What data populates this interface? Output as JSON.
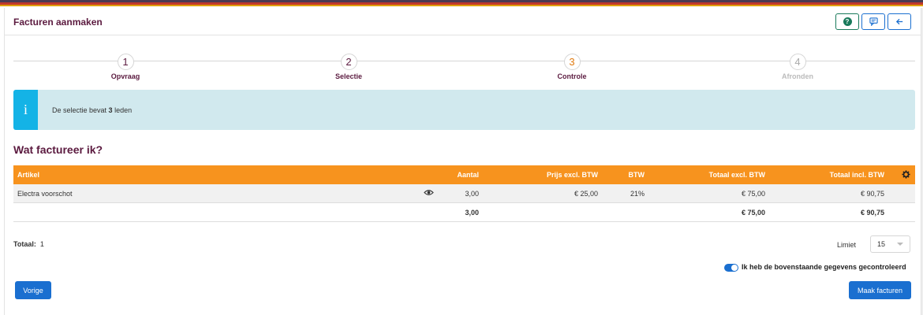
{
  "header": {
    "title": "Facturen aanmaken",
    "help_icon": "question-circle-icon",
    "feedback_icon": "comment-icon",
    "back_icon": "arrow-left-icon"
  },
  "steps": [
    {
      "number": "1",
      "label": "Opvraag",
      "state": "done"
    },
    {
      "number": "2",
      "label": "Selectie",
      "state": "done"
    },
    {
      "number": "3",
      "label": "Controle",
      "state": "current"
    },
    {
      "number": "4",
      "label": "Afronden",
      "state": "disabled"
    }
  ],
  "alert": {
    "icon": "info-icon",
    "text_before": "De selectie bevat ",
    "count": "3",
    "text_after": " leden"
  },
  "section_title": "Wat factureer ik?",
  "table": {
    "columns": {
      "artikel": "Artikel",
      "aantal": "Aantal",
      "prijs": "Prijs excl. BTW",
      "btw": "BTW",
      "totaal_excl": "Totaal excl. BTW",
      "totaal_incl": "Totaal incl. BTW"
    },
    "rows": [
      {
        "artikel": "Electra voorschot",
        "aantal": "3,00",
        "prijs": "€ 25,00",
        "btw": "21%",
        "totaal_excl": "€ 75,00",
        "totaal_incl": "€ 90,75"
      }
    ],
    "totals": {
      "aantal": "3,00",
      "totaal_excl": "€ 75,00",
      "totaal_incl": "€ 90,75"
    }
  },
  "footer": {
    "totaal_label": "Totaal:",
    "totaal_value": "1",
    "limiet_label": "Limiet",
    "limiet_value": "15"
  },
  "confirm": {
    "label": "Ik heb de bovenstaande gegevens gecontroleerd",
    "checked": true
  },
  "buttons": {
    "prev": "Vorige",
    "make": "Maak facturen"
  },
  "colors": {
    "brand": "#5b1a3f",
    "accent": "#f7931e",
    "primary": "#1a6fd0",
    "info": "#14b3e6"
  }
}
